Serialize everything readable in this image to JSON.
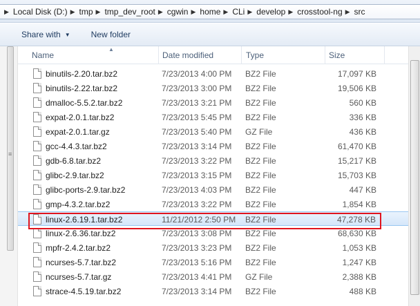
{
  "breadcrumb": {
    "items": [
      "Local Disk (D:)",
      "tmp",
      "tmp_dev_root",
      "cgwin",
      "home",
      "CLi",
      "develop",
      "crosstool-ng",
      "src"
    ]
  },
  "toolbar": {
    "share_label": "Share with",
    "new_folder_label": "New folder"
  },
  "columns": {
    "name": "Name",
    "date": "Date modified",
    "type": "Type",
    "size": "Size"
  },
  "files": [
    {
      "name": "binutils-2.20.tar.bz2",
      "date": "7/23/2013 4:00 PM",
      "type": "BZ2 File",
      "size": "17,097 KB"
    },
    {
      "name": "binutils-2.22.tar.bz2",
      "date": "7/23/2013 3:00 PM",
      "type": "BZ2 File",
      "size": "19,506 KB"
    },
    {
      "name": "dmalloc-5.5.2.tar.bz2",
      "date": "7/23/2013 3:21 PM",
      "type": "BZ2 File",
      "size": "560 KB"
    },
    {
      "name": "expat-2.0.1.tar.bz2",
      "date": "7/23/2013 5:45 PM",
      "type": "BZ2 File",
      "size": "336 KB"
    },
    {
      "name": "expat-2.0.1.tar.gz",
      "date": "7/23/2013 5:40 PM",
      "type": "GZ File",
      "size": "436 KB"
    },
    {
      "name": "gcc-4.4.3.tar.bz2",
      "date": "7/23/2013 3:14 PM",
      "type": "BZ2 File",
      "size": "61,470 KB"
    },
    {
      "name": "gdb-6.8.tar.bz2",
      "date": "7/23/2013 3:22 PM",
      "type": "BZ2 File",
      "size": "15,217 KB"
    },
    {
      "name": "glibc-2.9.tar.bz2",
      "date": "7/23/2013 3:15 PM",
      "type": "BZ2 File",
      "size": "15,703 KB"
    },
    {
      "name": "glibc-ports-2.9.tar.bz2",
      "date": "7/23/2013 4:03 PM",
      "type": "BZ2 File",
      "size": "447 KB"
    },
    {
      "name": "gmp-4.3.2.tar.bz2",
      "date": "7/23/2013 3:22 PM",
      "type": "BZ2 File",
      "size": "1,854 KB"
    },
    {
      "name": "linux-2.6.19.1.tar.bz2",
      "date": "11/21/2012 2:50 PM",
      "type": "BZ2 File",
      "size": "47,278 KB"
    },
    {
      "name": "linux-2.6.36.tar.bz2",
      "date": "7/23/2013 3:08 PM",
      "type": "BZ2 File",
      "size": "68,630 KB"
    },
    {
      "name": "mpfr-2.4.2.tar.bz2",
      "date": "7/23/2013 3:23 PM",
      "type": "BZ2 File",
      "size": "1,053 KB"
    },
    {
      "name": "ncurses-5.7.tar.bz2",
      "date": "7/23/2013 5:16 PM",
      "type": "BZ2 File",
      "size": "1,247 KB"
    },
    {
      "name": "ncurses-5.7.tar.gz",
      "date": "7/23/2013 4:41 PM",
      "type": "GZ File",
      "size": "2,388 KB"
    },
    {
      "name": "strace-4.5.19.tar.bz2",
      "date": "7/23/2013 3:14 PM",
      "type": "BZ2 File",
      "size": "488 KB"
    }
  ],
  "selected_index": 10,
  "colors": {
    "highlight_border": "#e0141e",
    "selection": "#d5e7fa"
  }
}
